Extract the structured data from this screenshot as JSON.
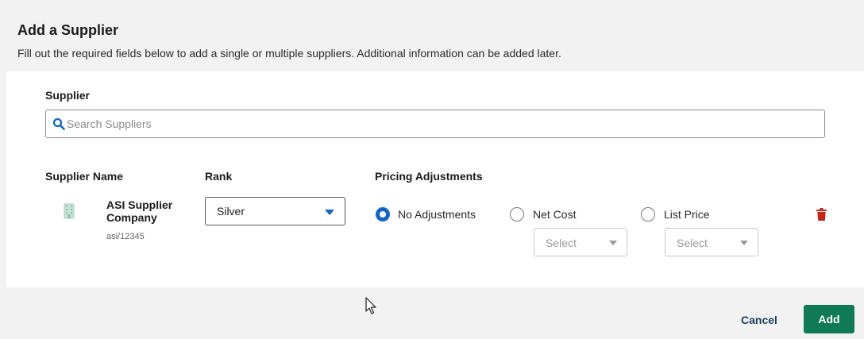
{
  "dialog": {
    "title": "Add a Supplier",
    "subtitle": "Fill out the required fields below to add a single or multiple suppliers. Additional information can be added later."
  },
  "supplier_search": {
    "label": "Supplier",
    "placeholder": "Search Suppliers",
    "icon": "search-icon"
  },
  "columns": {
    "supplier_name": "Supplier Name",
    "rank": "Rank",
    "pricing_adjustments": "Pricing Adjustments"
  },
  "supplier_row": {
    "name": "ASI Supplier Company",
    "asi_id": "asi/12345",
    "icon": "building-icon",
    "rank_value": "Silver",
    "pricing_options": [
      {
        "label": "No Adjustments",
        "selected": true
      },
      {
        "label": "Net Cost",
        "selected": false
      },
      {
        "label": "List Price",
        "selected": false
      }
    ],
    "net_cost_select": "Select",
    "list_price_select": "Select"
  },
  "footer": {
    "cancel_label": "Cancel",
    "add_label": "Add"
  },
  "colors": {
    "accent_blue": "#1565c0",
    "add_green": "#0f7a55",
    "trash_red": "#c0281c"
  }
}
